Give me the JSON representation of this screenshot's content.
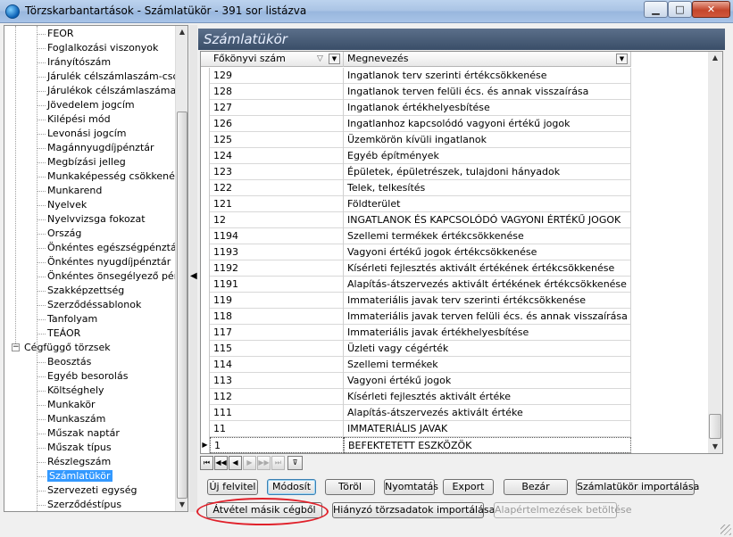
{
  "window": {
    "title": "Törzskarbantartások - Számlatükör - 391 sor listázva",
    "minimize_glyph": "▁",
    "maximize_glyph": "□",
    "close_glyph": "✕"
  },
  "tree": {
    "items_level2_group1": [
      "FEOR",
      "Foglalkozási viszonyok",
      "Irányítószám",
      "Járulék célszámlaszám-csoport",
      "Járulékok célszámlaszáma",
      "Jövedelem jogcím",
      "Kilépési mód",
      "Levonási jogcím",
      "Magánnyugdíjpénztár",
      "Megbízási jelleg",
      "Munkaképesség csökkenés",
      "Munkarend",
      "Nyelvek",
      "Nyelvvizsga fokozat",
      "Ország",
      "Önkéntes egészségpénztár",
      "Önkéntes nyugdíjpénztár",
      "Önkéntes önsegélyező pénztár",
      "Szakképzettség",
      "Szerződéssablonok",
      "Tanfolyam",
      "TEÁOR"
    ],
    "group2_label": "Cégfüggő törzsek",
    "group2_expander": "−",
    "items_level2_group2": [
      "Beosztás",
      "Egyéb besorolás",
      "Költséghely",
      "Munkakör",
      "Munkaszám",
      "Műszak naptár",
      "Műszak típus",
      "Részlegszám",
      "Számlatükör",
      "Szervezeti egység",
      "Szerződéstípus"
    ],
    "selected": "Számlatükör"
  },
  "panel": {
    "title": "Számlatükör"
  },
  "grid": {
    "columns": [
      "Főkönyvi szám",
      "Megnevezés"
    ],
    "sort_glyph": "▽",
    "rows": [
      [
        "129",
        "Ingatlanok terv szerinti értékcsökkenése"
      ],
      [
        "128",
        "Ingatlanok terven felüli écs. és annak visszaírása"
      ],
      [
        "127",
        "Ingatlanok értékhelyesbítése"
      ],
      [
        "126",
        "Ingatlanhoz kapcsolódó vagyoni értékű jogok"
      ],
      [
        "125",
        "Üzemkörön kívüli ingatlanok"
      ],
      [
        "124",
        "Egyéb építmények"
      ],
      [
        "123",
        "Épületek, épületrészek, tulajdoni hányadok"
      ],
      [
        "122",
        "Telek, telkesítés"
      ],
      [
        "121",
        "Földterület"
      ],
      [
        "12",
        "INGATLANOK ÉS KAPCSOLÓDÓ VAGYONI ÉRTÉKŰ JOGOK"
      ],
      [
        "1194",
        "Szellemi termékek értékcsökkenése"
      ],
      [
        "1193",
        "Vagyoni értékű jogok értékcsökkenése"
      ],
      [
        "1192",
        "Kísérleti fejlesztés aktivált értékének értékcsökkenése"
      ],
      [
        "1191",
        "Alapítás-átszervezés aktivált értékének értékcsökkenése"
      ],
      [
        "119",
        "Immateriális javak terv szerinti értékcsökkenése"
      ],
      [
        "118",
        "Immateriális javak terven felüli écs. és annak visszaírása"
      ],
      [
        "117",
        "Immateriális javak értékhelyesbítése"
      ],
      [
        "115",
        "Üzleti vagy cégérték"
      ],
      [
        "114",
        "Szellemi termékek"
      ],
      [
        "113",
        "Vagyoni értékű jogok"
      ],
      [
        "112",
        "Kísérleti fejlesztés aktivált értéke"
      ],
      [
        "111",
        "Alapítás-átszervezés aktivált értéke"
      ],
      [
        "11",
        "IMMATERIÁLIS JAVAK"
      ],
      [
        "1",
        "BEFEKTETETT ESZKÖZÖK"
      ]
    ],
    "current_row_marker": "▶"
  },
  "navigator": {
    "first": "⏮",
    "prev_page": "◀◀",
    "prev": "◀",
    "next": "▶",
    "next_page": "▶▶",
    "last": "⏭",
    "filter": "⊽"
  },
  "buttons": {
    "new": "Új felvitel",
    "modify": "Módosít",
    "delete": "Töröl",
    "print": "Nyomtatás",
    "export": "Export",
    "close": "Bezár",
    "import_chart": "Számlatükör importálása",
    "take_over": "Átvétel másik cégből",
    "import_missing": "Hiányzó törzsadatok importálása",
    "load_defaults": "Alapértelmezések betöltése"
  },
  "colors": {
    "header_bar": "#3a4e68",
    "selection": "#3399ff",
    "highlight_ellipse": "#e0202a"
  }
}
